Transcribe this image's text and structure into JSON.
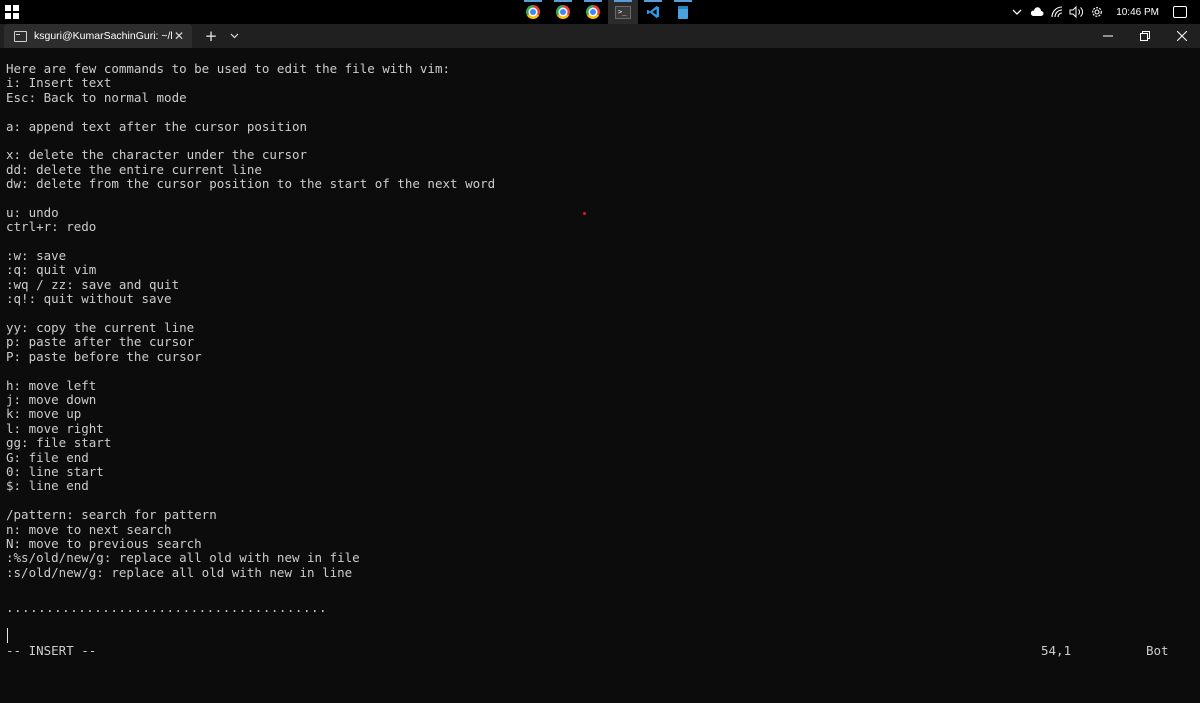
{
  "taskbar": {
    "pinned_apps": [
      {
        "icon": "chrome-icon",
        "name": "Google Chrome"
      },
      {
        "icon": "chrome-icon",
        "name": "Google Chrome"
      },
      {
        "icon": "chrome-icon",
        "name": "Google Chrome"
      },
      {
        "icon": "terminal-icon",
        "name": "Windows Terminal"
      },
      {
        "icon": "vscode-icon",
        "name": "Visual Studio Code"
      },
      {
        "icon": "notepad-icon",
        "name": "Notepad"
      }
    ],
    "clock": "10:46 PM"
  },
  "terminal_tab": {
    "title": "ksguri@KumarSachinGuri: ~/l",
    "close_label": "✕",
    "new_tab_label": "+"
  },
  "window_controls": {
    "minimize": "—",
    "maximize": "❐",
    "close": "✕"
  },
  "editor": {
    "lines": [
      "Here are few commands to be used to edit the file with vim:",
      "i: Insert text",
      "Esc: Back to normal mode",
      "",
      "a: append text after the cursor position",
      "",
      "x: delete the character under the cursor",
      "dd: delete the entire current line",
      "dw: delete from the cursor position to the start of the next word",
      "",
      "u: undo",
      "ctrl+r: redo",
      "",
      ":w: save",
      ":q: quit vim",
      ":wq / zz: save and quit",
      ":q!: quit without save",
      "",
      "yy: copy the current line",
      "p: paste after the cursor",
      "P: paste before the cursor",
      "",
      "h: move left",
      "j: move down",
      "k: move up",
      "l: move right",
      "gg: file start",
      "G: file end",
      "0: line start",
      "$: line end",
      "",
      "/pattern: search for pattern",
      "n: move to next search",
      "N: move to previous search",
      ":%s/old/new/g: replace all old with new in file",
      ":s/old/new/g: replace all old with new in line"
    ],
    "dotted_line": "........................................"
  },
  "statusline": {
    "mode": "-- INSERT --",
    "position": "54,1",
    "scroll": "Bot"
  },
  "colors": {
    "background": "#0c0c0c",
    "text": "#cccccc",
    "taskbar": "#000000",
    "tabbar": "#202020",
    "tab_active": "#2d2d2d"
  }
}
